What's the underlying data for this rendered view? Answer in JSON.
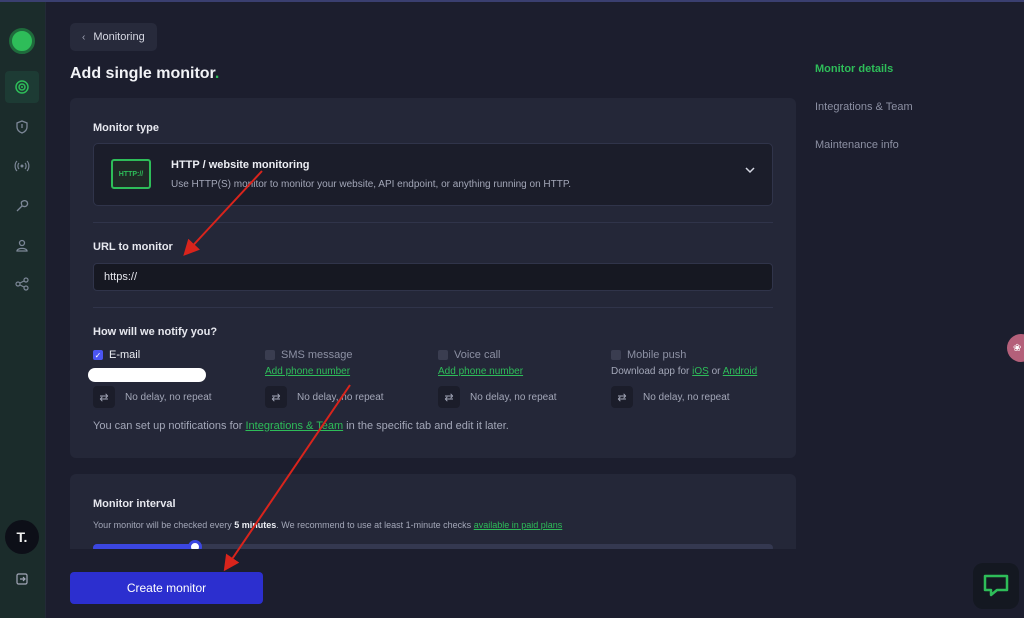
{
  "header": {
    "back_label": "Monitoring",
    "page_title": "Add single monitor",
    "page_title_dot": "."
  },
  "monitor_type": {
    "label": "Monitor type",
    "selected_title": "HTTP / website monitoring",
    "selected_desc": "Use HTTP(S) monitor to monitor your website, API endpoint, or anything running on HTTP.",
    "icon_text": "HTTP://"
  },
  "url": {
    "label": "URL to monitor",
    "value": "https://"
  },
  "notify": {
    "label": "How will we notify you?",
    "channels": [
      {
        "label": "E-mail",
        "checked": true,
        "repeat": "No delay, no repeat"
      },
      {
        "label": "SMS message",
        "checked": false,
        "link": "Add phone number",
        "repeat": "No delay, no repeat"
      },
      {
        "label": "Voice call",
        "checked": false,
        "link": "Add phone number",
        "repeat": "No delay, no repeat"
      },
      {
        "label": "Mobile push",
        "checked": false,
        "text_prefix": "Download app for ",
        "ios": "iOS",
        "or": " or ",
        "android": "Android",
        "repeat": "No delay, no repeat"
      }
    ],
    "note_prefix": "You can set up notifications for ",
    "note_link": "Integrations & Team",
    "note_suffix": " in the specific tab and edit it later."
  },
  "interval": {
    "label": "Monitor interval",
    "note_prefix": "Your monitor will be checked every ",
    "note_bold": "5 minutes",
    "note_middle": ". We recommend to use at least 1-minute checks ",
    "note_link": "available in paid plans",
    "slider_fraction": 0.15
  },
  "actions": {
    "create_label": "Create monitor"
  },
  "right_nav": {
    "items": [
      "Monitor details",
      "Integrations & Team",
      "Maintenance info"
    ]
  },
  "sidebar": {
    "avatar_text": "T."
  },
  "colors": {
    "accent_green": "#2ebd59",
    "primary_blue": "#2c2fcf",
    "annotation_red": "#d9241c"
  }
}
